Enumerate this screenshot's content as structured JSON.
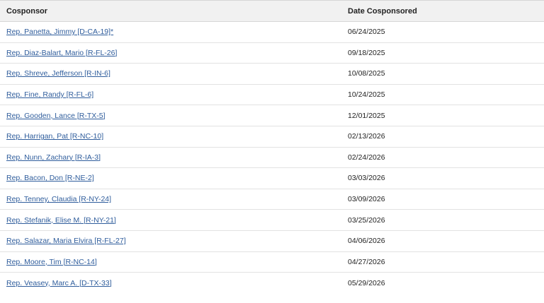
{
  "table": {
    "headers": {
      "cosponsor": "Cosponsor",
      "date": "Date Cosponsored"
    },
    "rows": [
      {
        "name": "Rep. Panetta, Jimmy [D-CA-19]*",
        "date": "06/24/2025"
      },
      {
        "name": "Rep. Diaz-Balart, Mario [R-FL-26]",
        "date": "09/18/2025"
      },
      {
        "name": "Rep. Shreve, Jefferson [R-IN-6]",
        "date": "10/08/2025"
      },
      {
        "name": "Rep. Fine, Randy [R-FL-6]",
        "date": "10/24/2025"
      },
      {
        "name": "Rep. Gooden, Lance [R-TX-5]",
        "date": "12/01/2025"
      },
      {
        "name": "Rep. Harrigan, Pat [R-NC-10]",
        "date": "02/13/2026"
      },
      {
        "name": "Rep. Nunn, Zachary [R-IA-3]",
        "date": "02/24/2026"
      },
      {
        "name": "Rep. Bacon, Don [R-NE-2]",
        "date": "03/03/2026"
      },
      {
        "name": "Rep. Tenney, Claudia [R-NY-24]",
        "date": "03/09/2026"
      },
      {
        "name": "Rep. Stefanik, Elise M. [R-NY-21]",
        "date": "03/25/2026"
      },
      {
        "name": "Rep. Salazar, Maria Elvira [R-FL-27]",
        "date": "04/06/2026"
      },
      {
        "name": "Rep. Moore, Tim [R-NC-14]",
        "date": "04/27/2026"
      },
      {
        "name": "Rep. Veasey, Marc A. [D-TX-33]",
        "date": "05/29/2026"
      }
    ]
  },
  "colors": {
    "link": "#2f5d9c",
    "header_bg": "#f1f1f1",
    "text": "#222222"
  }
}
